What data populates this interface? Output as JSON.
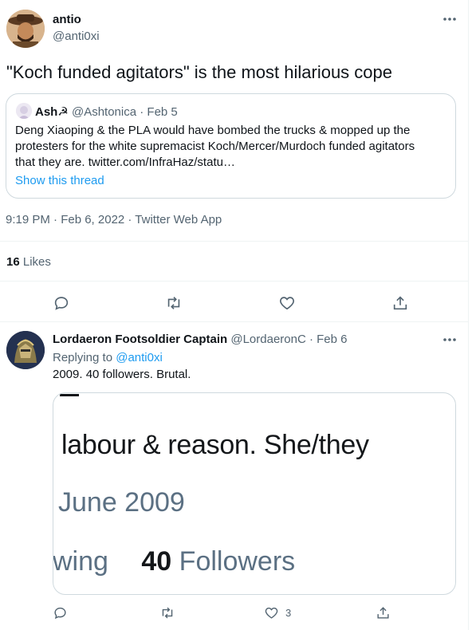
{
  "main_tweet": {
    "author_name": "antio",
    "author_handle": "@anti0xi",
    "text": "\"Koch funded agitators\" is the most hilarious cope",
    "quote": {
      "author_name": "Ash☭",
      "author_handle": "@Ashtonica",
      "date": "· Feb 5",
      "text": "Deng Xiaoping & the PLA would have bombed the trucks & mopped up the protesters for the white supremacist Koch/Mercer/Murdoch funded agitators that they are. twitter.com/InfraHaz/statu…",
      "show_thread": "Show this thread"
    },
    "timestamp": "9:19 PM · Feb 6, 2022 · Twitter Web App",
    "likes_count": "16",
    "likes_label": "Likes"
  },
  "reply": {
    "author_name": "Lordaeron Footsoldier Captain",
    "author_handle": "@LordaeronC",
    "date": "· Feb 6",
    "replying_prefix": "Replying to",
    "replying_handle": "@anti0xi",
    "text": "2009. 40 followers. Brutal.",
    "image_lines": {
      "line1": "labour & reason.  She/they",
      "line2": "June 2009",
      "line3_prefix": "wing",
      "line3_count": "40",
      "line3_label": "Followers"
    },
    "like_count": "3"
  },
  "icons": [
    "more-icon",
    "reply-icon",
    "retweet-icon",
    "like-icon",
    "share-icon"
  ],
  "colors": {
    "accent": "#1d9bf0",
    "text": "#0f1419",
    "muted": "#536471",
    "border": "#cfd9de"
  }
}
